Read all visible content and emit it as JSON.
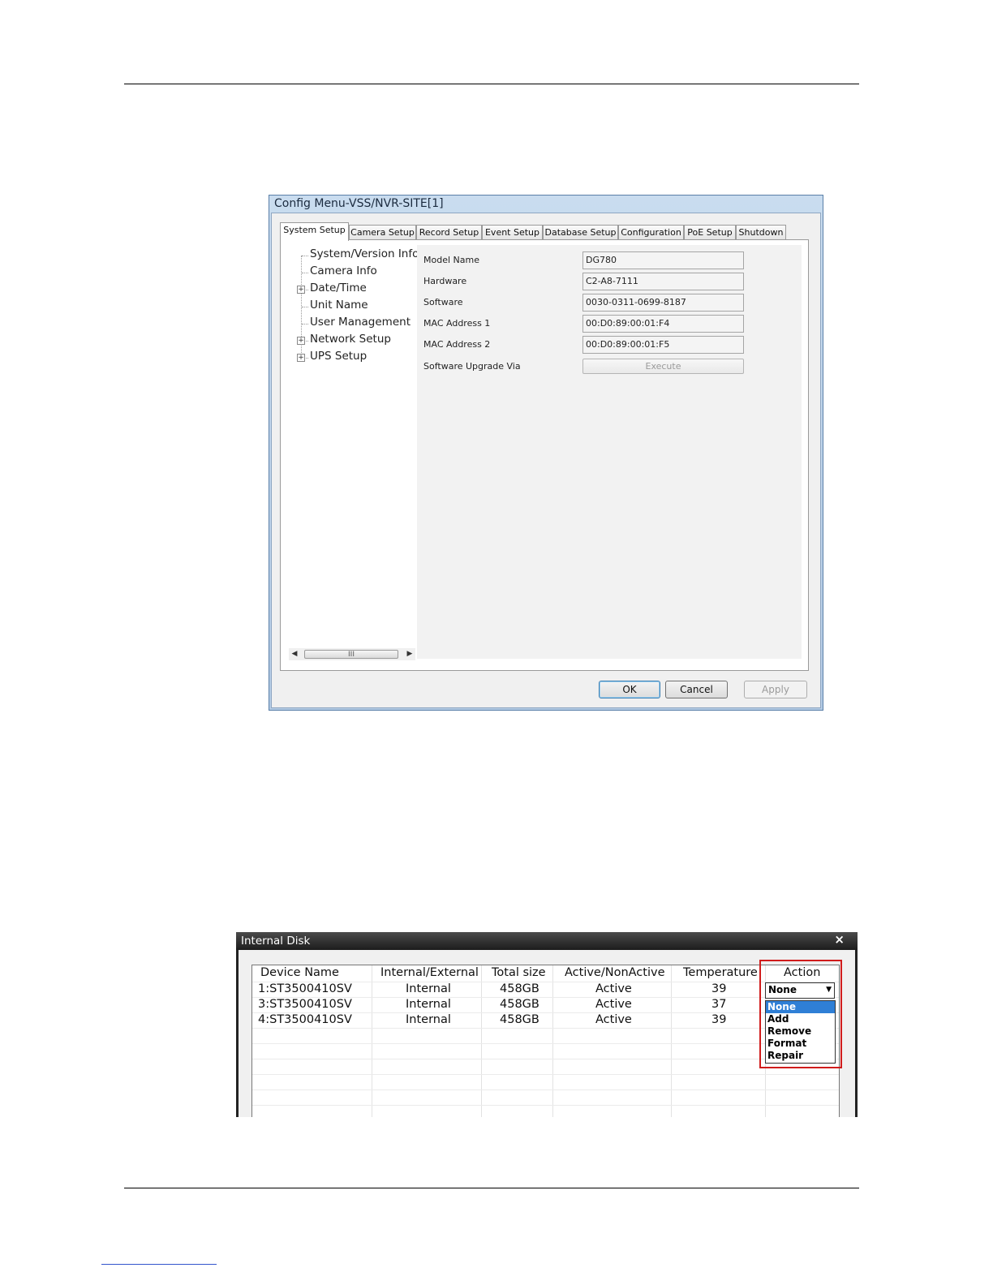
{
  "config_dialog": {
    "title": "Config Menu-VSS/NVR-SITE[1]",
    "tabs": [
      "System Setup",
      "Camera Setup",
      "Record Setup",
      "Event Setup",
      "Database Setup",
      "Configuration",
      "PoE Setup",
      "Shutdown"
    ],
    "active_tab": "System Setup",
    "tree": [
      {
        "label": "System/Version Info",
        "expandable": false
      },
      {
        "label": "Camera Info",
        "expandable": false
      },
      {
        "label": "Date/Time",
        "expandable": true
      },
      {
        "label": "Unit Name",
        "expandable": false
      },
      {
        "label": "User Management",
        "expandable": false
      },
      {
        "label": "Network Setup",
        "expandable": true
      },
      {
        "label": "UPS Setup",
        "expandable": true
      }
    ],
    "scrollbar_thumb_glyph": "III",
    "properties": [
      {
        "label": "Model Name",
        "value": "DG780"
      },
      {
        "label": "Hardware",
        "value": "C2-A8-7111"
      },
      {
        "label": "Software",
        "value": "0030-0311-0699-8187"
      },
      {
        "label": "MAC Address 1",
        "value": "00:D0:89:00:01:F4"
      },
      {
        "label": "MAC Address 2",
        "value": "00:D0:89:00:01:F5"
      }
    ],
    "upgrade": {
      "label": "Software Upgrade Via",
      "button": "Execute"
    },
    "buttons": {
      "ok": "OK",
      "cancel": "Cancel",
      "apply": "Apply"
    }
  },
  "internal_disk": {
    "title": "Internal Disk",
    "close_glyph": "×",
    "columns": [
      "Device Name",
      "Internal/External",
      "Total size",
      "Active/NonActive",
      "Temperature",
      "Action"
    ],
    "rows": [
      {
        "device": "1:ST3500410SV",
        "type": "Internal",
        "size": "458GB",
        "status": "Active",
        "temp": "39"
      },
      {
        "device": "3:ST3500410SV",
        "type": "Internal",
        "size": "458GB",
        "status": "Active",
        "temp": "37"
      },
      {
        "device": "4:ST3500410SV",
        "type": "Internal",
        "size": "458GB",
        "status": "Active",
        "temp": "39"
      }
    ],
    "action_select": {
      "value": "None",
      "options": [
        "None",
        "Add",
        "Remove",
        "Format",
        "Repair"
      ],
      "highlight_color": "#d01c1c"
    }
  }
}
